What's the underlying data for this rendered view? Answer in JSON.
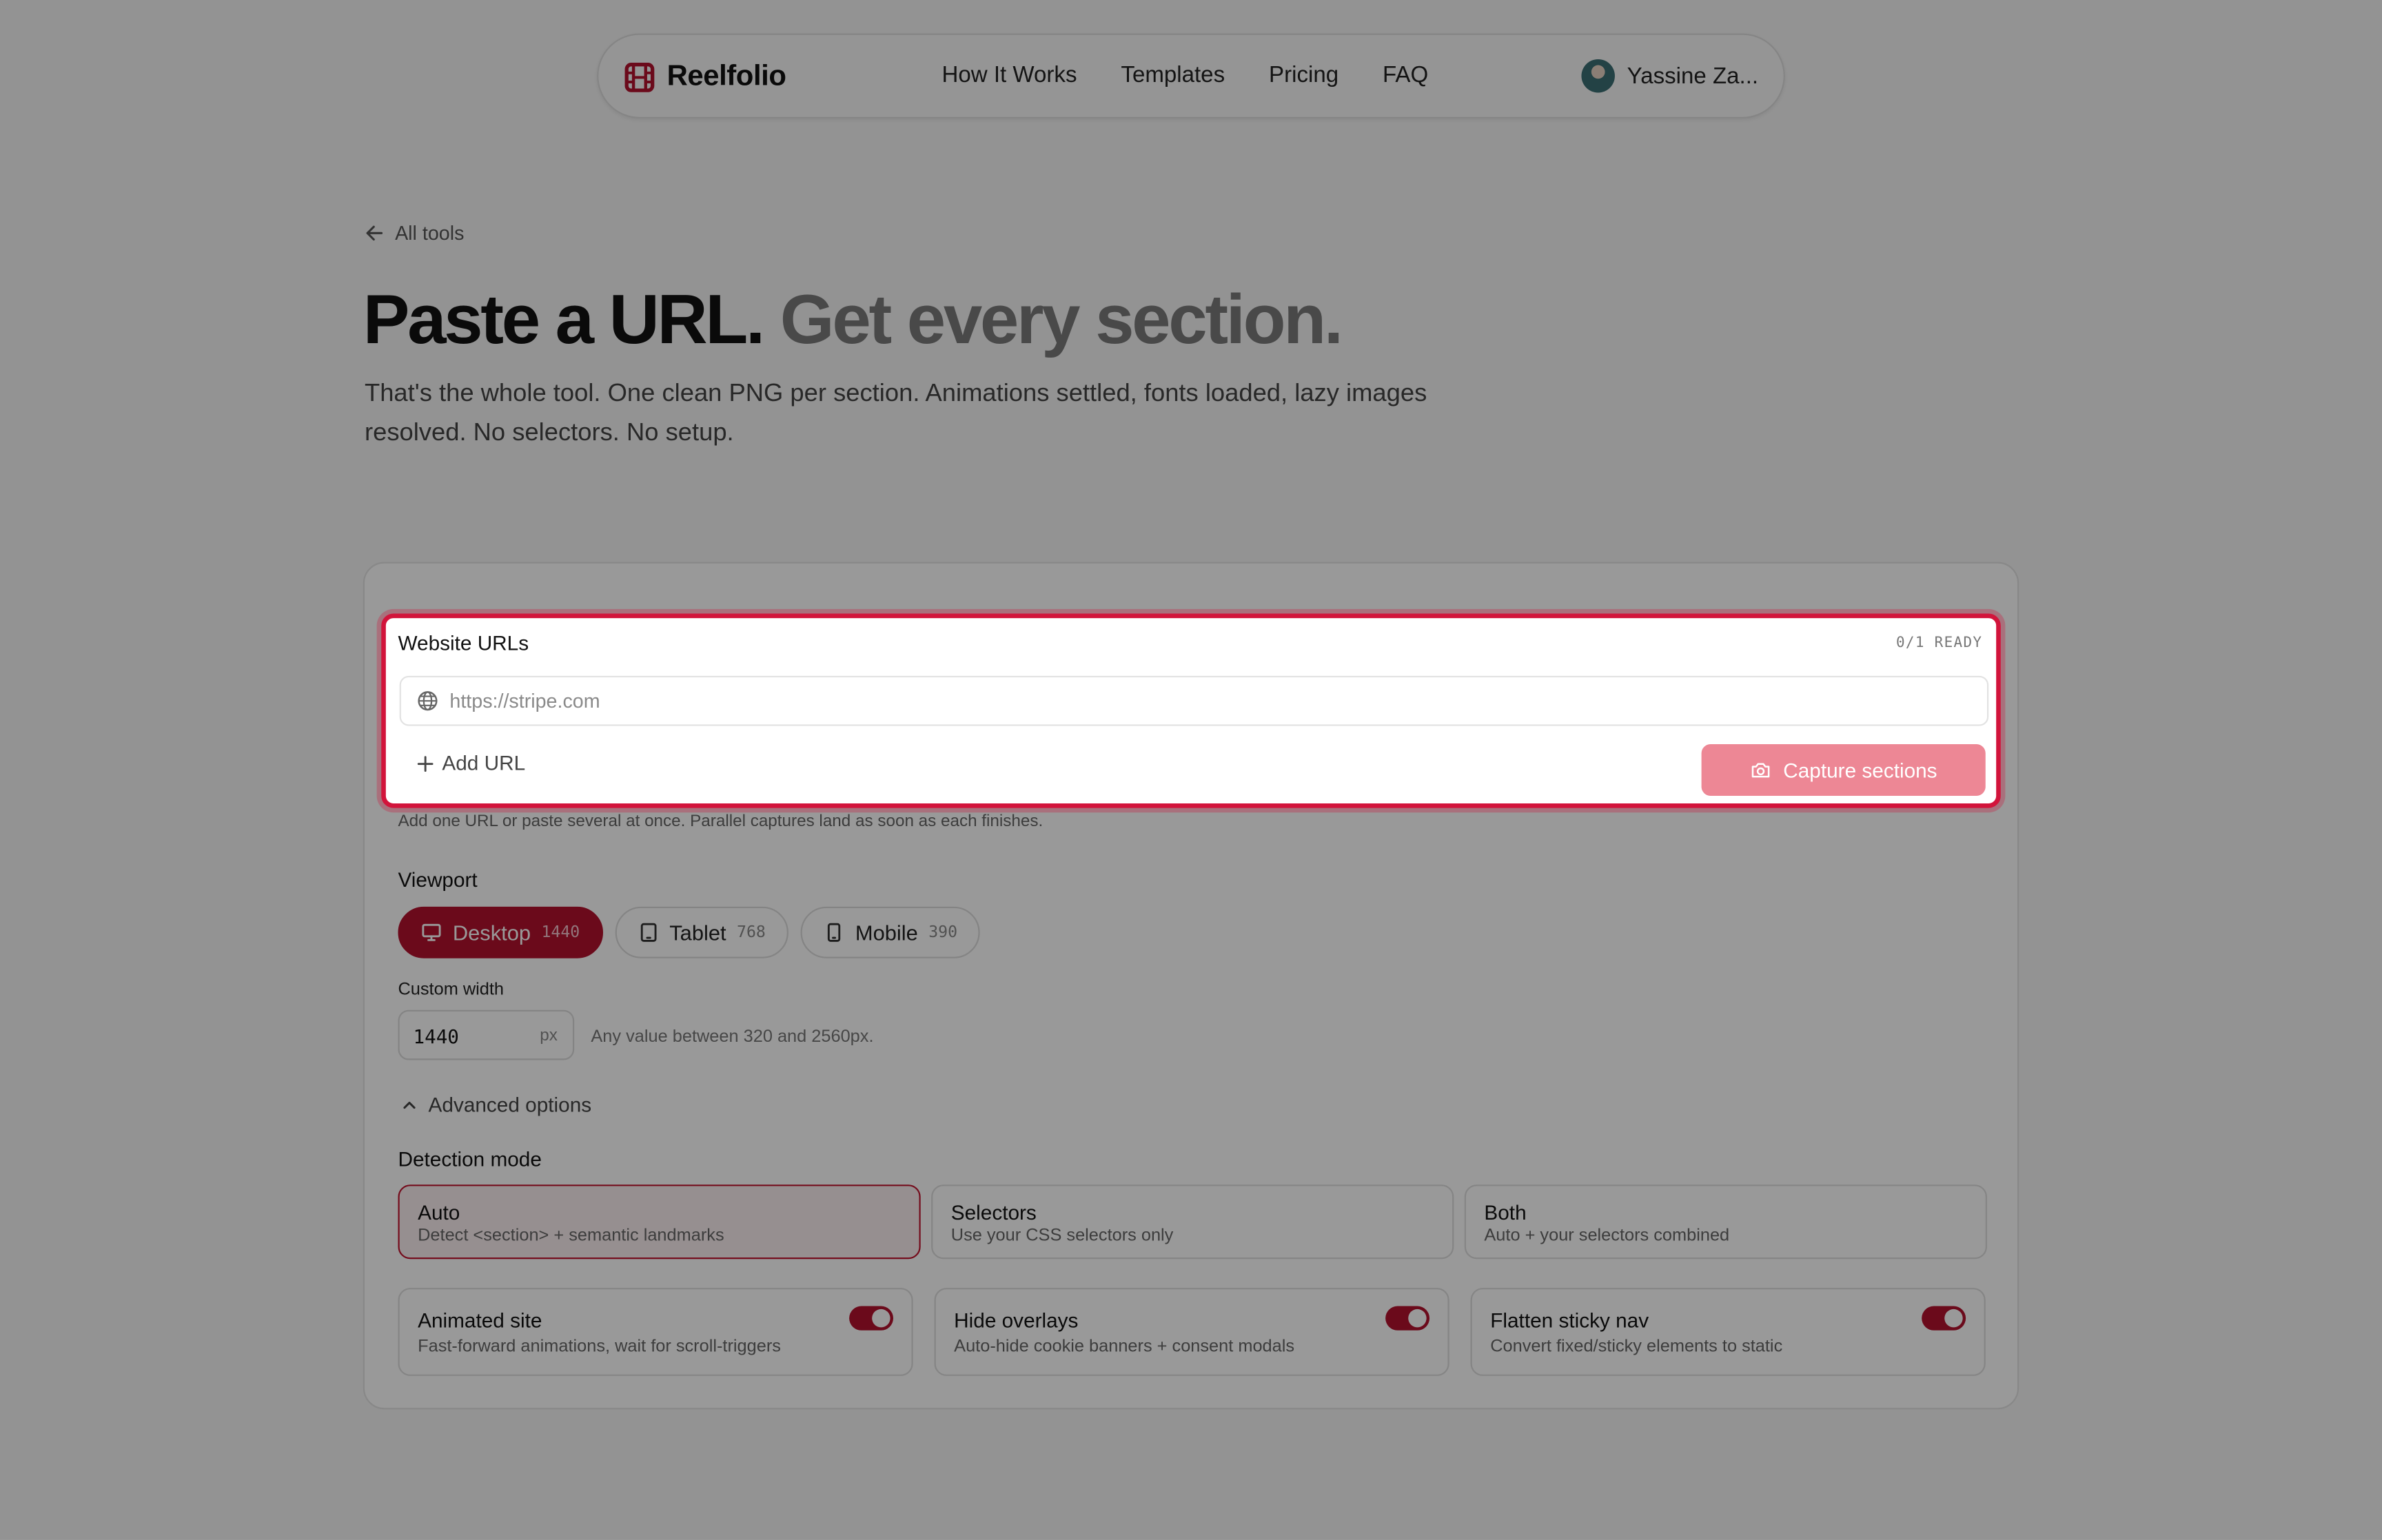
{
  "nav": {
    "logo": "Reelfolio",
    "links": [
      "How It Works",
      "Templates",
      "Pricing",
      "FAQ"
    ],
    "user_name": "Yassine Za..."
  },
  "hero": {
    "back_link": "All tools",
    "title_main": "Paste a URL.",
    "title_muted": "Get every section.",
    "subtitle": "That's the whole tool. One clean PNG per section. Animations settled, fonts loaded, lazy images resolved. No selectors. No setup."
  },
  "urls": {
    "title": "Website URLs",
    "status": "0/1 READY",
    "placeholder": "https://stripe.com",
    "value": "",
    "add_label": "Add URL",
    "capture_label": "Capture sections",
    "hint": "Add one URL or paste several at once. Parallel captures land as soon as each finishes."
  },
  "viewport": {
    "label": "Viewport",
    "options": [
      {
        "label": "Desktop",
        "width": "1440",
        "icon": "monitor-icon",
        "selected": true
      },
      {
        "label": "Tablet",
        "width": "768",
        "icon": "tablet-icon",
        "selected": false
      },
      {
        "label": "Mobile",
        "width": "390",
        "icon": "phone-icon",
        "selected": false
      }
    ]
  },
  "custom_width": {
    "label": "Custom width",
    "value": "1440",
    "unit": "px",
    "help": "Any value between 320 and 2560px."
  },
  "advanced": {
    "label": "Advanced options",
    "expanded": true
  },
  "detection": {
    "label": "Detection mode",
    "modes": [
      {
        "title": "Auto",
        "desc": "Detect <section> + semantic landmarks",
        "selected": true
      },
      {
        "title": "Selectors",
        "desc": "Use your CSS selectors only",
        "selected": false
      },
      {
        "title": "Both",
        "desc": "Auto + your selectors combined",
        "selected": false
      }
    ]
  },
  "toggles": [
    {
      "title": "Animated site",
      "desc": "Fast-forward animations, wait for scroll-triggers",
      "on": true
    },
    {
      "title": "Hide overlays",
      "desc": "Auto-hide cookie banners + consent modals",
      "on": true
    },
    {
      "title": "Flatten sticky nav",
      "desc": "Convert fixed/sticky elements to static",
      "on": true
    }
  ],
  "colors": {
    "accent": "#b3112e",
    "highlight_border": "#d2143b",
    "capture_button_disabled": "#ed8795",
    "overlay": "rgba(0,0,0,0.40)"
  }
}
